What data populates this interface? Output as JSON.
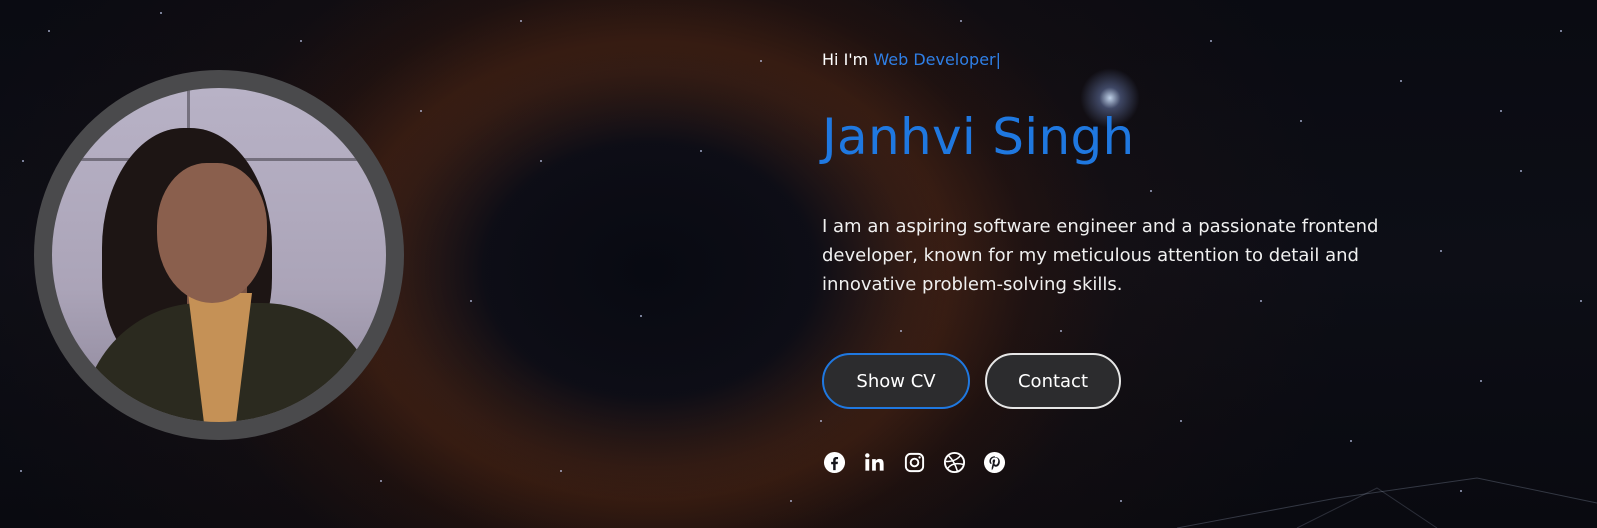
{
  "hero": {
    "greeting_prefix": "Hi I'm ",
    "role": "Web Developer",
    "cursor": "|",
    "name": "Janhvi Singh",
    "bio": "I am an aspiring software engineer and a passionate frontend developer, known for my meticulous attention to detail and innovative problem-solving skills."
  },
  "buttons": {
    "show_cv": "Show CV",
    "contact": "Contact"
  },
  "socials": [
    {
      "icon": "facebook-icon"
    },
    {
      "icon": "linkedin-icon"
    },
    {
      "icon": "instagram-icon"
    },
    {
      "icon": "dribbble-icon"
    },
    {
      "icon": "pinterest-icon"
    }
  ],
  "colors": {
    "accent": "#1f78e0",
    "button_bg": "#2c2c2e",
    "ring": "#4a4a4c"
  }
}
